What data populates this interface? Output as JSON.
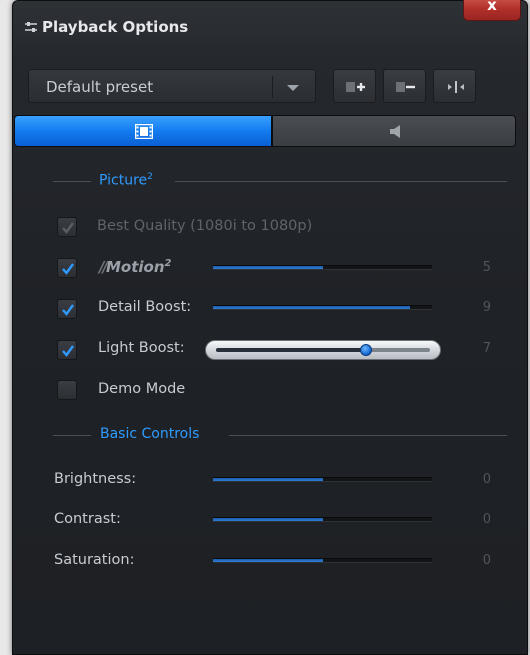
{
  "window": {
    "title": "Playback Options",
    "close_label": "x"
  },
  "preset": {
    "selected": "Default preset"
  },
  "tabs": [
    {
      "name": "video",
      "icon": "film-icon",
      "active": true
    },
    {
      "name": "audio",
      "icon": "speaker-icon",
      "active": false
    }
  ],
  "sections": {
    "picture": {
      "label": "Picture",
      "sup": "2"
    },
    "basic": {
      "label": "Basic Controls"
    }
  },
  "picture": {
    "best_quality": {
      "label": "Best Quality (1080i to 1080p)",
      "checked": true,
      "enabled": false
    },
    "motion": {
      "label": "Motion",
      "sup": "2",
      "checked": true,
      "value": "5",
      "level": 0.5
    },
    "detail_boost": {
      "label": "Detail Boost:",
      "checked": true,
      "value": "9",
      "level": 0.9
    },
    "light_boost": {
      "label": "Light Boost:",
      "checked": true,
      "value": "7",
      "level": 0.7
    },
    "demo_mode": {
      "label": "Demo Mode",
      "checked": false
    }
  },
  "basic": {
    "brightness": {
      "label": "Brightness:",
      "value": "0",
      "level": 0.5
    },
    "contrast": {
      "label": "Contrast:",
      "value": "0",
      "level": 0.5
    },
    "saturation": {
      "label": "Saturation:",
      "value": "0",
      "level": 0.5
    }
  },
  "colors": {
    "accent": "#2f9bff",
    "tab_active": "#137cf0",
    "close": "#b1302a"
  }
}
